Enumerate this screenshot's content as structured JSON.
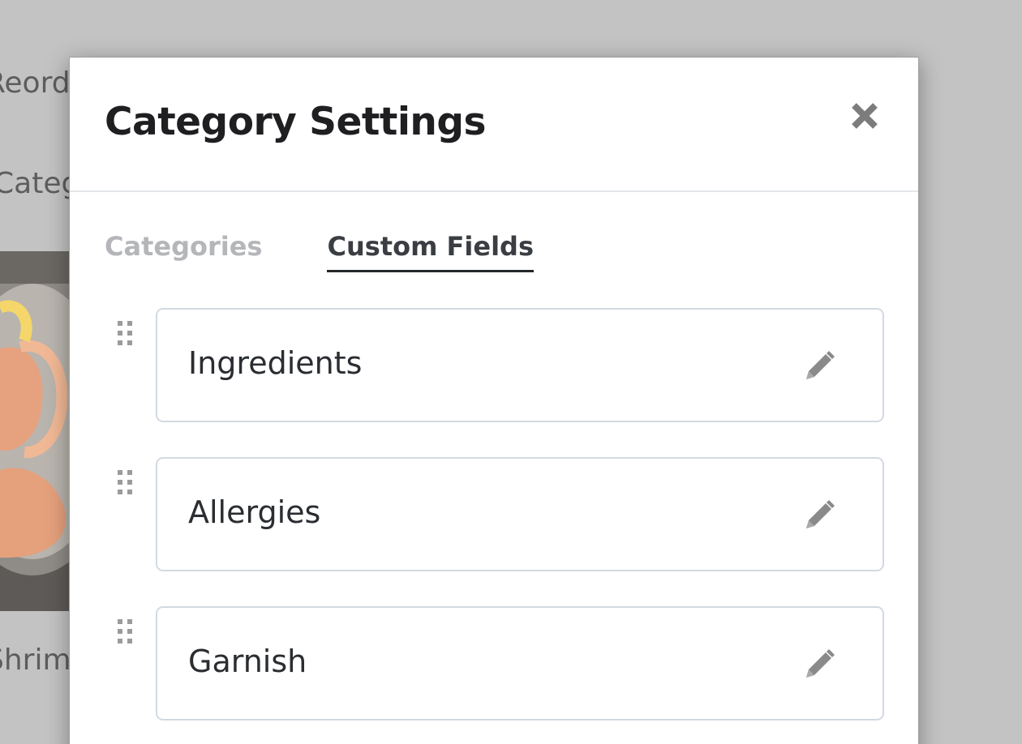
{
  "background": {
    "reorder_fragment": "Reorder",
    "category_fragment": "Category...",
    "dish_fragment": "Shrimp Cocktail"
  },
  "modal": {
    "title": "Category Settings",
    "close_icon": "close-icon",
    "tabs": [
      {
        "label": "Categories",
        "active": false
      },
      {
        "label": "Custom Fields",
        "active": true
      }
    ],
    "custom_fields": [
      {
        "label": "Ingredients",
        "edit_icon": "pencil-icon",
        "drag_icon": "drag-handle-icon"
      },
      {
        "label": "Allergies",
        "edit_icon": "pencil-icon",
        "drag_icon": "drag-handle-icon"
      },
      {
        "label": "Garnish",
        "edit_icon": "pencil-icon",
        "drag_icon": "drag-handle-icon"
      }
    ]
  },
  "colors": {
    "overlay": "#c3c3c3",
    "title": "#1f1f22",
    "tab_active": "#3a3d41",
    "tab_inactive": "#b4b6ba",
    "field_border": "#d3d9e2",
    "icon": "#8a8a8a"
  }
}
